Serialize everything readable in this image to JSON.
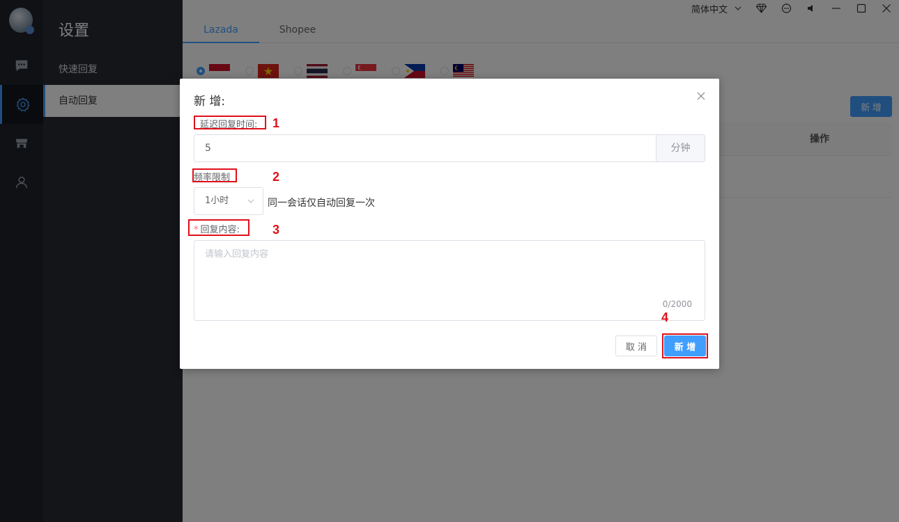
{
  "sidebar": {
    "title": "设置",
    "items": [
      {
        "label": "快速回复"
      },
      {
        "label": "自动回复"
      }
    ]
  },
  "rail": {
    "icons": [
      "chat-bubble-icon",
      "gear-icon",
      "store-icon",
      "user-icon"
    ]
  },
  "topbar": {
    "language": "简体中文",
    "icons": [
      "chevron-down-icon",
      "diamond-icon",
      "message-icon",
      "speaker-icon",
      "minimize-icon",
      "maximize-icon",
      "close-icon"
    ]
  },
  "tabs": [
    {
      "label": "Lazada",
      "active": true
    },
    {
      "label": "Shopee",
      "active": false
    }
  ],
  "countries": [
    "indonesia-flag-icon",
    "vietnam-flag-icon",
    "thailand-flag-icon",
    "singapore-flag-icon",
    "philippines-flag-icon",
    "malaysia-flag-icon"
  ],
  "main": {
    "add_label": "新 增",
    "table_header_op": "操作"
  },
  "dialog": {
    "title": "新 增:",
    "delay_label": "延迟回复时间:",
    "delay_value": "5",
    "delay_unit": "分钟",
    "freq_label": "频率限制",
    "freq_value": "1小时",
    "freq_note": "同一会话仅自动回复一次",
    "content_required": "*",
    "content_label": "回复内容:",
    "content_placeholder": "请输入回复内容",
    "content_counter": "0/2000",
    "cancel_label": "取 消",
    "ok_label": "新 增"
  },
  "annotations": [
    "1",
    "2",
    "3",
    "4"
  ],
  "colors": {
    "accent": "#409eff",
    "highlight": "#e0101a"
  }
}
